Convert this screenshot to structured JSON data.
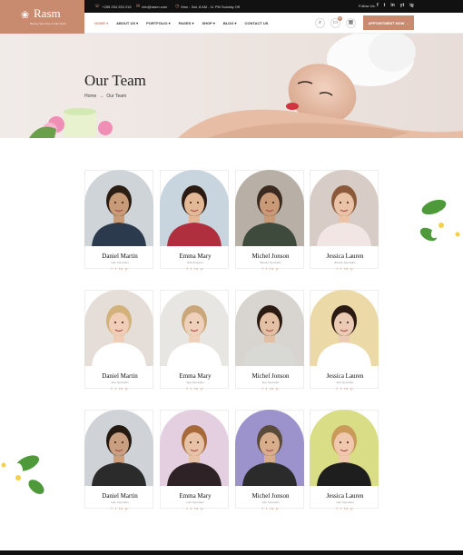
{
  "header": {
    "logo_name": "Rasm",
    "logo_tagline": "Beauty Spa Care & Nail Salon",
    "phone": "+255 254 253 215",
    "email": "info@rasm.com",
    "hours": "Mon - Sat, 8 AM - 11 PM Sunday Off",
    "follow_label": "Follow Us:",
    "social": [
      "f",
      "t",
      "in",
      "yt",
      "ig"
    ]
  },
  "nav": {
    "items": [
      "HOME",
      "ABOUT US",
      "PORTFOLIO",
      "PAGES",
      "SHOP",
      "BLOG",
      "CONTACT US"
    ],
    "cart_count": "0",
    "appointment_label": "APPOINTMENT NOW"
  },
  "hero": {
    "title": "Our Team",
    "breadcrumb_home": "Home",
    "breadcrumb_current": "Our Team"
  },
  "team": [
    {
      "name": "Daniel Martin",
      "role": "Hair Specialist",
      "bg": "#cfd4d8",
      "skin": "#c79a78",
      "hair": "#2a1d14",
      "outfit": "#2c3a4d"
    },
    {
      "name": "Emma Mary",
      "role": "Nail Designer",
      "bg": "#c8d4de",
      "skin": "#e3b896",
      "hair": "#2b1a12",
      "outfit": "#b02f3f"
    },
    {
      "name": "Michel Jonson",
      "role": "Beauty Specialist",
      "bg": "#b8b0a6",
      "skin": "#c99a78",
      "hair": "#3a2a1f",
      "outfit": "#3e4a3b"
    },
    {
      "name": "Jessica Lauren",
      "role": "Beauty Specialist",
      "bg": "#d8ccc6",
      "skin": "#eac2a6",
      "hair": "#8a5a3a",
      "outfit": "#f2e6e4"
    },
    {
      "name": "Daniel Martin",
      "role": "Spa Specialist",
      "bg": "#e4ddd8",
      "skin": "#efcdb6",
      "hair": "#d2b27a",
      "outfit": "#ffffff"
    },
    {
      "name": "Emma Mary",
      "role": "Spa Specialist",
      "bg": "#e8e6e2",
      "skin": "#efd0ba",
      "hair": "#c9a77a",
      "outfit": "#ffffff"
    },
    {
      "name": "Michel Jonson",
      "role": "Spa Specialist",
      "bg": "#d8d4cf",
      "skin": "#e3c0a4",
      "hair": "#2a1a12",
      "outfit": "#d8d8d4"
    },
    {
      "name": "Jessica Lauren",
      "role": "Spa Specialist",
      "bg": "#ebd9a8",
      "skin": "#eccbb4",
      "hair": "#2a1a12",
      "outfit": "#ffffff"
    },
    {
      "name": "Daniel Martin",
      "role": "Hair Specialist",
      "bg": "#cfd2d6",
      "skin": "#c89f80",
      "hair": "#241a12",
      "outfit": "#2b2b2b"
    },
    {
      "name": "Emma Mary",
      "role": "Hair Specialist",
      "bg": "#e3cfdf",
      "skin": "#e8c2a6",
      "hair": "#a66a3a",
      "outfit": "#2e2226"
    },
    {
      "name": "Michel Jonson",
      "role": "Hair Specialist",
      "bg": "#9c93cc",
      "skin": "#d8ad8c",
      "hair": "#5a4a3a",
      "outfit": "#2b2b2b"
    },
    {
      "name": "Jessica Lauren",
      "role": "Hair Specialist",
      "bg": "#d9de86",
      "skin": "#efc8ad",
      "hair": "#c99a5a",
      "outfit": "#1e1e1e"
    }
  ],
  "card_social": [
    "f",
    "t",
    "in",
    "p"
  ],
  "colors": {
    "accent": "#c98b6f",
    "dark": "#111111"
  }
}
